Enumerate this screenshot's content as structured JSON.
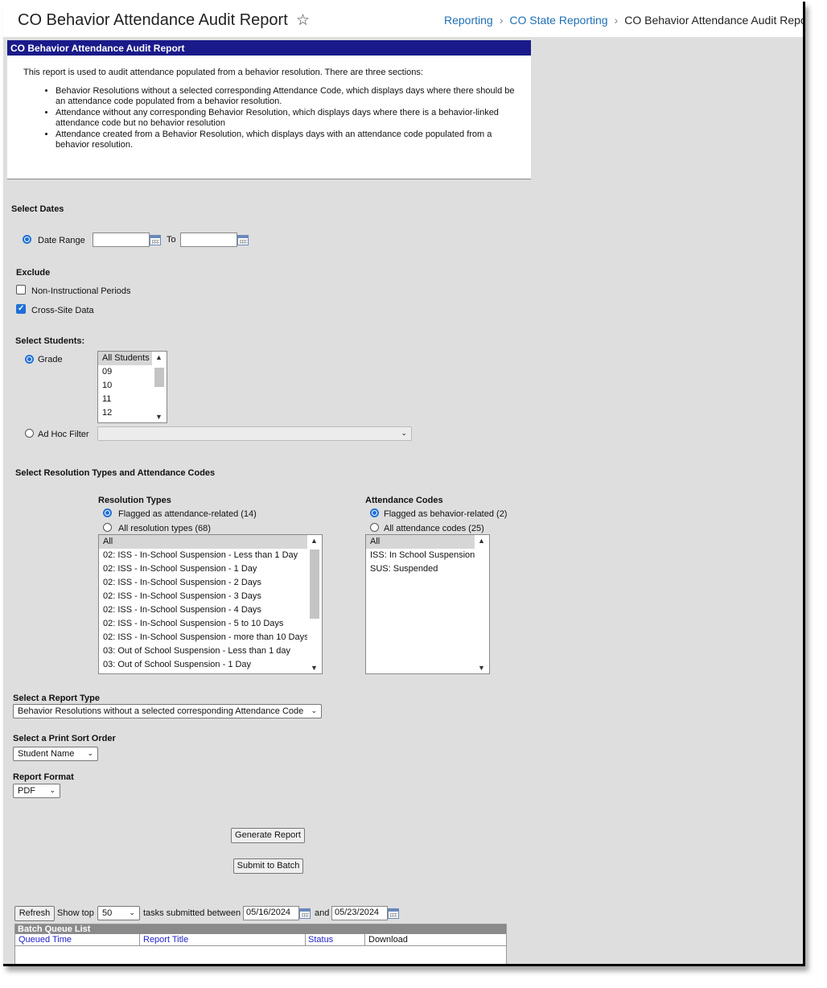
{
  "header": {
    "title": "CO Behavior Attendance Audit Report",
    "breadcrumbs": [
      "Reporting",
      "CO State Reporting",
      "CO Behavior Attendance Audit Report"
    ]
  },
  "info": {
    "heading": "CO Behavior Attendance Audit Report",
    "intro": "This report is used to audit attendance populated from a behavior resolution. There are three sections:",
    "bullets": [
      "Behavior Resolutions without a selected corresponding Attendance Code, which displays days where there should be an attendance code populated from a behavior resolution.",
      "Attendance without any corresponding Behavior Resolution, which displays days where there is a behavior-linked attendance code but no behavior resolution",
      "Attendance created from a Behavior Resolution, which displays days with an attendance code populated from a behavior resolution."
    ]
  },
  "dates": {
    "section_label": "Select Dates",
    "date_range_label": "Date Range",
    "to_label": "To",
    "start_value": "",
    "end_value": ""
  },
  "exclude": {
    "label": "Exclude",
    "non_instructional": {
      "label": "Non-Instructional Periods",
      "checked": false
    },
    "cross_site": {
      "label": "Cross-Site Data",
      "checked": true
    }
  },
  "students": {
    "section_label": "Select Students:",
    "grade_label": "Grade",
    "grades": [
      "All Students",
      "09",
      "10",
      "11",
      "12"
    ],
    "adhoc_label": "Ad Hoc Filter",
    "adhoc_value": ""
  },
  "resolution": {
    "section_label": "Select Resolution Types and Attendance Codes",
    "types_label": "Resolution Types",
    "flagged_label": "Flagged as attendance-related (14)",
    "all_label": "All resolution types (68)",
    "types": [
      "All",
      "02: ISS - In-School Suspension - Less than 1 Day",
      "02: ISS - In-School Suspension - 1 Day",
      "02: ISS - In-School Suspension - 2 Days",
      "02: ISS - In-School Suspension - 3 Days",
      "02: ISS - In-School Suspension - 4 Days",
      "02: ISS - In-School Suspension - 5 to 10 Days",
      "02: ISS - In-School Suspension - more than 10 Days",
      "03: Out of School Suspension - Less than 1 day",
      "03: Out of School Suspension - 1 Day"
    ],
    "codes_label": "Attendance Codes",
    "codes_flagged_label": "Flagged as behavior-related (2)",
    "codes_all_label": "All attendance codes (25)",
    "codes": [
      "All",
      "ISS: In School Suspension",
      "SUS: Suspended"
    ]
  },
  "report_type": {
    "label": "Select a Report Type",
    "value": "Behavior Resolutions without a selected corresponding Attendance Code"
  },
  "sort_order": {
    "label": "Select a Print Sort Order",
    "value": "Student Name"
  },
  "format": {
    "label": "Report Format",
    "value": "PDF"
  },
  "buttons": {
    "generate": "Generate Report",
    "batch": "Submit to Batch"
  },
  "queue": {
    "refresh": "Refresh",
    "show_top": "Show top",
    "count": "50",
    "between": "tasks submitted between",
    "from": "05/16/2024",
    "and": "and",
    "to": "05/23/2024",
    "title": "Batch Queue List",
    "columns": [
      "Queued Time",
      "Report Title",
      "Status",
      "Download"
    ]
  }
}
